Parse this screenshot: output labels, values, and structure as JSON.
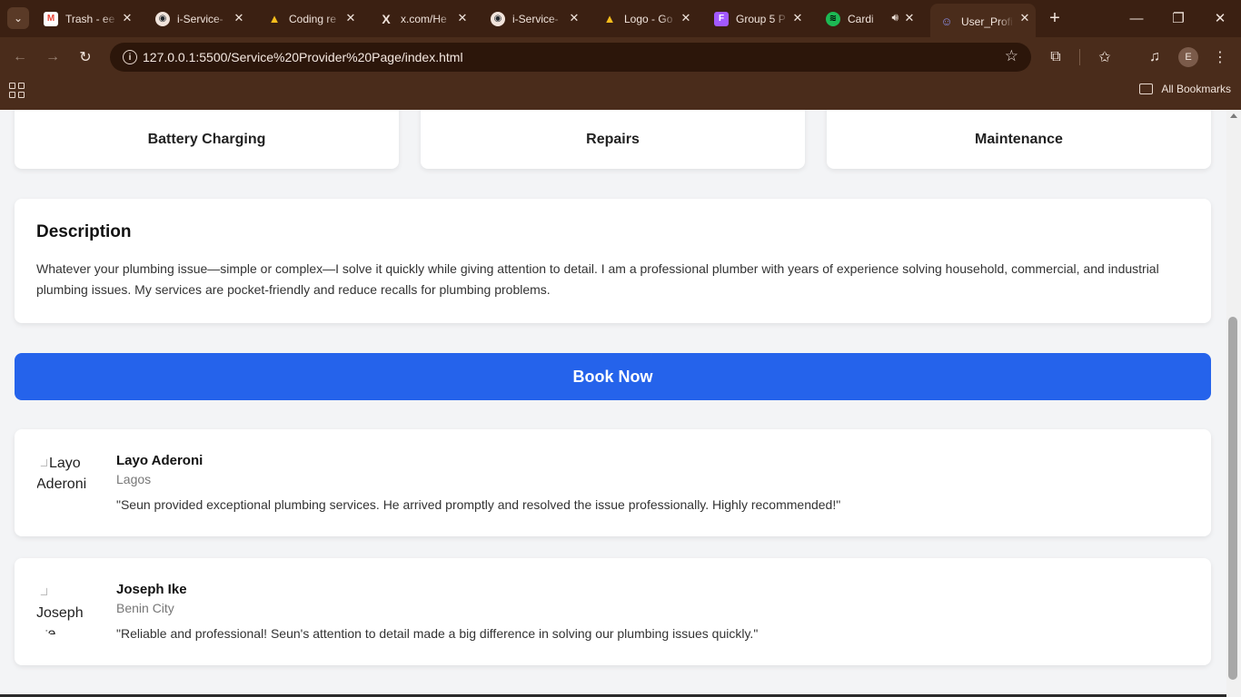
{
  "browser": {
    "tabs": [
      {
        "title": "Trash - ee",
        "icon": "gmail-icon",
        "color": "#ea4335",
        "glyph": "M"
      },
      {
        "title": "i-Service-",
        "icon": "github-icon",
        "color": "#24292e",
        "glyph": "◉"
      },
      {
        "title": "Coding re",
        "icon": "google-drive-icon",
        "color": "#1fa463",
        "glyph": "▲"
      },
      {
        "title": "x.com/He",
        "icon": "x-icon",
        "color": "#000000",
        "glyph": "X"
      },
      {
        "title": "i-Service-",
        "icon": "github-icon",
        "color": "#24292e",
        "glyph": "◉"
      },
      {
        "title": "Logo - Go",
        "icon": "google-drive-icon",
        "color": "#1fa463",
        "glyph": "▲"
      },
      {
        "title": "Group 5 P",
        "icon": "figma-icon",
        "color": "#f24e1e",
        "glyph": "F"
      },
      {
        "title": "Cardi",
        "icon": "spotify-icon",
        "color": "#1db954",
        "glyph": "≋"
      },
      {
        "title": "User_Profi",
        "icon": "user-profile-icon",
        "color": "#5b5fc7",
        "glyph": "☺"
      }
    ],
    "url": "127.0.0.1:5500/Service%20Provider%20Page/index.html",
    "bookmarks_label": "All Bookmarks",
    "profile_initial": "E"
  },
  "services": [
    "Battery Charging",
    "Repairs",
    "Maintenance"
  ],
  "description": {
    "heading": "Description",
    "text": "Whatever your plumbing issue—simple or complex—I solve it quickly while giving attention to detail. I am a professional plumber with years of experience solving household, commercial, and industrial plumbing issues. My services are pocket-friendly and reduce recalls for plumbing problems."
  },
  "book_button": "Book Now",
  "reviews": [
    {
      "name": "Layo Aderoni",
      "city": "Lagos",
      "alt": "Layo Aderoni",
      "text": "\"Seun provided exceptional plumbing services. He arrived promptly and resolved the issue professionally. Highly recommended!\""
    },
    {
      "name": "Joseph Ike",
      "city": "Benin City",
      "alt": "Joseph Ike",
      "text": "\"Reliable and professional! Seun's attention to detail made a big difference in solving our plumbing issues quickly.\""
    }
  ],
  "colors": {
    "accent": "#2563eb",
    "chrome": "#4a2c1b"
  }
}
